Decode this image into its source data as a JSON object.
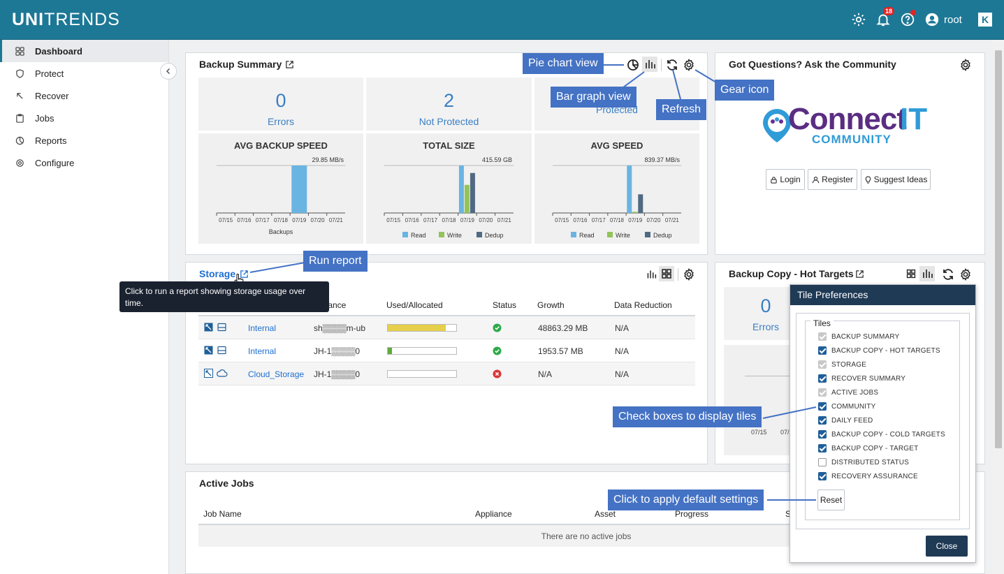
{
  "brand": {
    "logo_bold": "UNI",
    "logo_rest": "TRENDS"
  },
  "topbar": {
    "notifications_count": "18",
    "user": "root",
    "k_label": "K"
  },
  "sidebar": {
    "items": [
      {
        "label": "Dashboard",
        "icon": "grid-icon"
      },
      {
        "label": "Protect",
        "icon": "shield-icon"
      },
      {
        "label": "Recover",
        "icon": "recover-icon"
      },
      {
        "label": "Jobs",
        "icon": "clipboard-icon"
      },
      {
        "label": "Reports",
        "icon": "pie-icon"
      },
      {
        "label": "Configure",
        "icon": "gear-icon"
      }
    ]
  },
  "backup_summary": {
    "title": "Backup Summary",
    "stats": [
      {
        "value": "0",
        "label": "Errors"
      },
      {
        "value": "2",
        "label": "Not Protected"
      },
      {
        "value": "",
        "label": "Protected"
      }
    ],
    "charts": [
      {
        "title": "AVG BACKUP SPEED",
        "peak_label": "29.85 MB/s",
        "xlabel": "Backups",
        "legend": []
      },
      {
        "title": "TOTAL SIZE",
        "peak_label": "415.59 GB",
        "xlabel": "",
        "legend": [
          "Read",
          "Write",
          "Dedup"
        ]
      },
      {
        "title": "AVG SPEED",
        "peak_label": "839.37 MB/s",
        "xlabel": "",
        "legend": [
          "Read",
          "Write",
          "Dedup"
        ]
      }
    ],
    "dates": [
      "07/15",
      "07/16",
      "07/17",
      "07/18",
      "07/19",
      "07/20",
      "07/21"
    ]
  },
  "chart_data": [
    {
      "type": "bar",
      "title": "AVG BACKUP SPEED",
      "categories": [
        "07/15",
        "07/16",
        "07/17",
        "07/18",
        "07/19",
        "07/20",
        "07/21"
      ],
      "series": [
        {
          "name": "",
          "values": [
            0,
            0,
            0,
            0,
            29.85,
            0,
            0
          ]
        }
      ],
      "xlabel": "Backups"
    },
    {
      "type": "bar",
      "title": "TOTAL SIZE",
      "categories": [
        "07/15",
        "07/16",
        "07/17",
        "07/18",
        "07/19",
        "07/20",
        "07/21"
      ],
      "series": [
        {
          "name": "Read",
          "values": [
            0,
            0,
            0,
            0,
            415.59,
            0,
            0
          ]
        },
        {
          "name": "Write",
          "values": [
            0,
            0,
            0,
            0,
            246,
            0,
            0
          ]
        },
        {
          "name": "Dedup",
          "values": [
            0,
            0,
            0,
            0,
            350,
            0,
            0
          ]
        }
      ]
    },
    {
      "type": "bar",
      "title": "AVG SPEED",
      "categories": [
        "07/15",
        "07/16",
        "07/17",
        "07/18",
        "07/19",
        "07/20",
        "07/21"
      ],
      "series": [
        {
          "name": "Read",
          "values": [
            0,
            0,
            0,
            0,
            839.37,
            0,
            0
          ]
        },
        {
          "name": "Write",
          "values": [
            0,
            0,
            0,
            0,
            20,
            0,
            0
          ]
        },
        {
          "name": "Dedup",
          "values": [
            0,
            0,
            0,
            0,
            330,
            0,
            0
          ]
        }
      ]
    }
  ],
  "community": {
    "title": "Got Questions? Ask the Community",
    "logo_main": "Connect",
    "logo_it": "IT",
    "logo_sub": "COMMUNITY",
    "buttons": [
      "Login",
      "Register",
      "Suggest Ideas"
    ]
  },
  "storage": {
    "title": "Storage",
    "tooltip": "Click to run a report showing storage usage over time.",
    "columns": [
      "liance",
      "Used/Allocated",
      "Status",
      "Growth",
      "Data Reduction"
    ],
    "rows": [
      {
        "name": "Internal",
        "appliance": "sh▒▒▒▒m-ub",
        "used_pct": 85,
        "bar_color": "#e6cf4a",
        "status": "ok",
        "growth": "48863.29 MB",
        "reduction": "N/A",
        "icon": "disk-icon"
      },
      {
        "name": "Internal",
        "appliance": "JH-1▒▒▒▒0",
        "used_pct": 6,
        "bar_color": "#5cad3c",
        "status": "ok",
        "growth": "1953.57 MB",
        "reduction": "N/A",
        "icon": "disk-icon"
      },
      {
        "name": "Cloud_Storage",
        "appliance": "JH-1▒▒▒▒0",
        "used_pct": 0,
        "bar_color": "#5cad3c",
        "status": "error",
        "growth": "N/A",
        "reduction": "N/A",
        "icon": "cloud-icon"
      }
    ]
  },
  "hot_targets": {
    "title": "Backup Copy - Hot Targets",
    "stat_value": "0",
    "stat_label": "Errors",
    "date_1": "07/15",
    "date_2": "07/"
  },
  "active_jobs": {
    "title": "Active Jobs",
    "columns": [
      "Job Name",
      "Appliance",
      "Asset",
      "Progress",
      "S"
    ],
    "empty": "There are no active jobs"
  },
  "tile_prefs": {
    "title": "Tile Preferences",
    "legend": "Tiles",
    "items": [
      {
        "label": "BACKUP SUMMARY",
        "state": "dis"
      },
      {
        "label": "BACKUP COPY - HOT TARGETS",
        "state": "on"
      },
      {
        "label": "STORAGE",
        "state": "dis"
      },
      {
        "label": "RECOVER SUMMARY",
        "state": "on"
      },
      {
        "label": "ACTIVE JOBS",
        "state": "dis"
      },
      {
        "label": "COMMUNITY",
        "state": "on"
      },
      {
        "label": "DAILY FEED",
        "state": "on"
      },
      {
        "label": "BACKUP COPY - COLD TARGETS",
        "state": "on"
      },
      {
        "label": "BACKUP COPY - TARGET",
        "state": "on"
      },
      {
        "label": "DISTRIBUTED STATUS",
        "state": "off"
      },
      {
        "label": "RECOVERY ASSURANCE",
        "state": "on"
      }
    ],
    "reset": "Reset",
    "close": "Close"
  },
  "callouts": {
    "pie": "Pie chart view",
    "bar": "Bar graph view",
    "refresh": "Refresh",
    "gear": "Gear icon",
    "run_report": "Run report",
    "check_boxes": "Check boxes to display tiles",
    "default_settings": "Click to apply default settings"
  },
  "colors": {
    "read": "#6ab4e2",
    "write": "#93c35a",
    "dedup": "#506a82",
    "accent": "#1d7896"
  }
}
